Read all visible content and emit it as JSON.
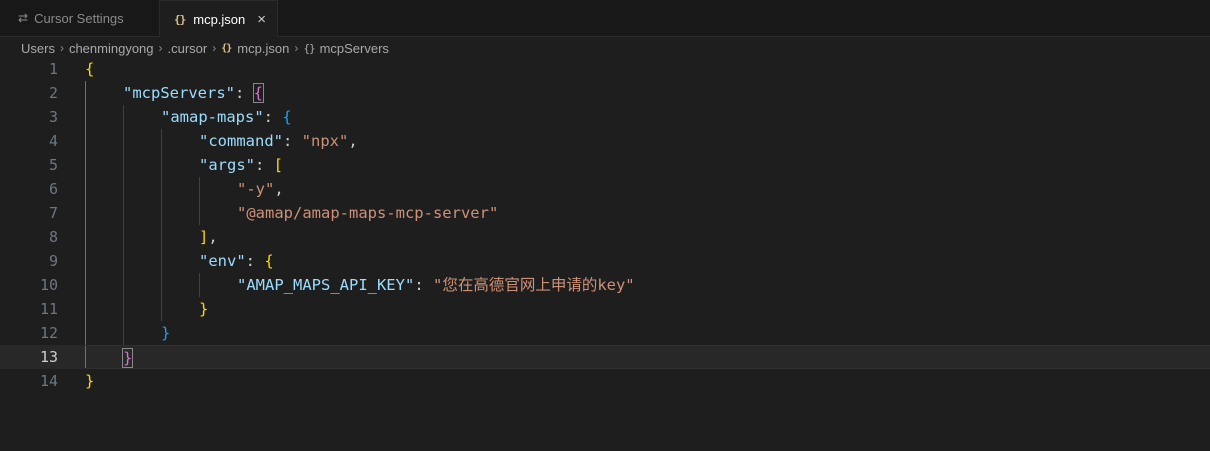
{
  "tabs": [
    {
      "label": "Cursor Settings",
      "icon": "settings-icon",
      "active": false
    },
    {
      "label": "mcp.json",
      "icon": "json-file-icon",
      "active": true,
      "close": "×"
    }
  ],
  "breadcrumb": {
    "items": [
      "Users",
      "chenmingyong",
      ".cursor",
      "mcp.json",
      "mcpServers"
    ],
    "separator": "›"
  },
  "editor": {
    "current_line": 13,
    "colors": {
      "key": "#9cdcfe",
      "string": "#ce9178",
      "bracket_level1": "#ffd700",
      "bracket_level2": "#da70d6",
      "bracket_level3": "#179fff"
    },
    "lines": [
      {
        "num": "1",
        "tokens": [
          {
            "t": "{",
            "c": "b1"
          }
        ]
      },
      {
        "num": "2",
        "tokens": [
          {
            "t": "\"mcpServers\"",
            "c": "key"
          },
          {
            "t": ": ",
            "c": "p"
          },
          {
            "t": "{",
            "c": "b2"
          }
        ]
      },
      {
        "num": "3",
        "tokens": [
          {
            "t": "\"amap-maps\"",
            "c": "key"
          },
          {
            "t": ": ",
            "c": "p"
          },
          {
            "t": "{",
            "c": "b3"
          }
        ]
      },
      {
        "num": "4",
        "tokens": [
          {
            "t": "\"command\"",
            "c": "key"
          },
          {
            "t": ": ",
            "c": "p"
          },
          {
            "t": "\"npx\"",
            "c": "str"
          },
          {
            "t": ",",
            "c": "p"
          }
        ]
      },
      {
        "num": "5",
        "tokens": [
          {
            "t": "\"args\"",
            "c": "key"
          },
          {
            "t": ": ",
            "c": "p"
          },
          {
            "t": "[",
            "c": "b1"
          }
        ]
      },
      {
        "num": "6",
        "tokens": [
          {
            "t": "\"-y\"",
            "c": "str"
          },
          {
            "t": ",",
            "c": "p"
          }
        ]
      },
      {
        "num": "7",
        "tokens": [
          {
            "t": "\"@amap/amap-maps-mcp-server\"",
            "c": "str"
          }
        ]
      },
      {
        "num": "8",
        "tokens": [
          {
            "t": "]",
            "c": "b1"
          },
          {
            "t": ",",
            "c": "p"
          }
        ]
      },
      {
        "num": "9",
        "tokens": [
          {
            "t": "\"env\"",
            "c": "key"
          },
          {
            "t": ": ",
            "c": "p"
          },
          {
            "t": "{",
            "c": "b1"
          }
        ]
      },
      {
        "num": "10",
        "tokens": [
          {
            "t": "\"AMAP_MAPS_API_KEY\"",
            "c": "key"
          },
          {
            "t": ": ",
            "c": "p"
          },
          {
            "t": "\"您在高德官网上申请的key\"",
            "c": "str"
          }
        ]
      },
      {
        "num": "11",
        "tokens": [
          {
            "t": "}",
            "c": "b1"
          }
        ]
      },
      {
        "num": "12",
        "tokens": [
          {
            "t": "}",
            "c": "b3"
          }
        ]
      },
      {
        "num": "13",
        "tokens": [
          {
            "t": "}",
            "c": "b2"
          }
        ]
      },
      {
        "num": "14",
        "tokens": [
          {
            "t": "}",
            "c": "b1"
          }
        ]
      }
    ]
  }
}
